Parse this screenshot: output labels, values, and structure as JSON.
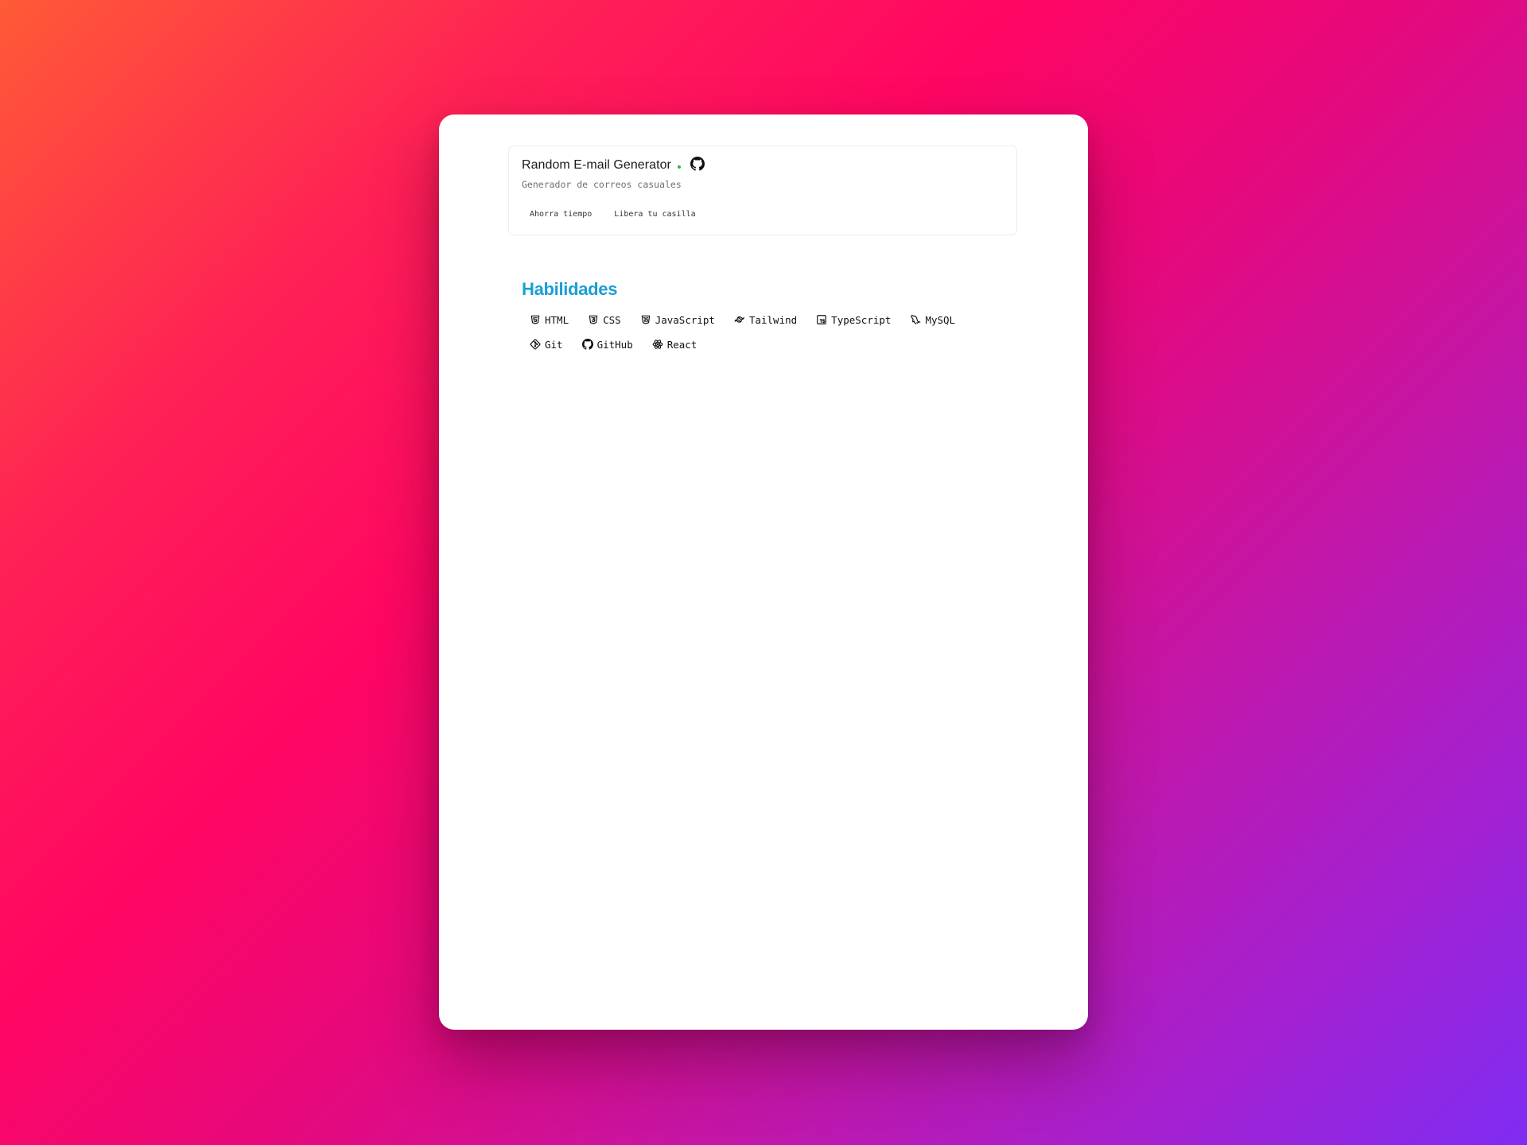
{
  "project": {
    "title": "Random E-mail Generator",
    "description": "Generador de correos casuales",
    "status_color": "#2bb24c",
    "link_icon": "github-icon",
    "tags": [
      "Ahorra tiempo",
      "Libera tu casilla"
    ]
  },
  "skills": {
    "title": "Habilidades",
    "title_color": "#1a9fd4",
    "items": [
      {
        "label": "HTML",
        "icon": "html5-icon"
      },
      {
        "label": "CSS",
        "icon": "css3-icon"
      },
      {
        "label": "JavaScript",
        "icon": "javascript-icon"
      },
      {
        "label": "Tailwind",
        "icon": "tailwind-icon"
      },
      {
        "label": "TypeScript",
        "icon": "typescript-icon"
      },
      {
        "label": "MySQL",
        "icon": "mysql-icon"
      },
      {
        "label": "Git",
        "icon": "git-icon"
      },
      {
        "label": "GitHub",
        "icon": "github-icon"
      },
      {
        "label": "React",
        "icon": "react-icon"
      }
    ]
  }
}
